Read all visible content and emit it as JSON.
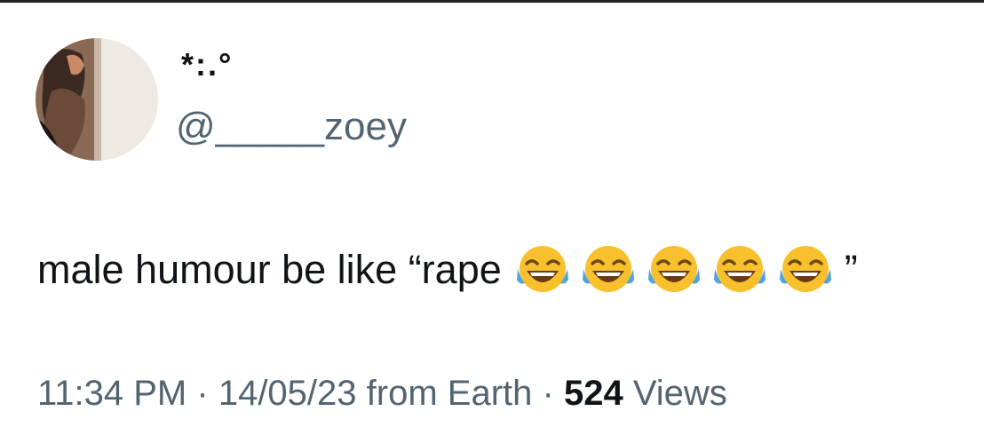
{
  "tweet": {
    "display_name": "*:.°",
    "handle": "@_____zoey",
    "text_before": "male humour be like “rape",
    "emoji_name": "face-with-tears-of-joy",
    "emoji_count": 5,
    "text_after": "”"
  },
  "meta": {
    "time": "11:34 PM",
    "separator": "·",
    "date": "14/05/23",
    "source": "from Earth",
    "views_count": "524",
    "views_label": "Views"
  },
  "colors": {
    "text": "#0f1419",
    "secondary": "#536471",
    "emoji_face": "#f7c02c",
    "emoji_tears": "#4fa3e0"
  }
}
